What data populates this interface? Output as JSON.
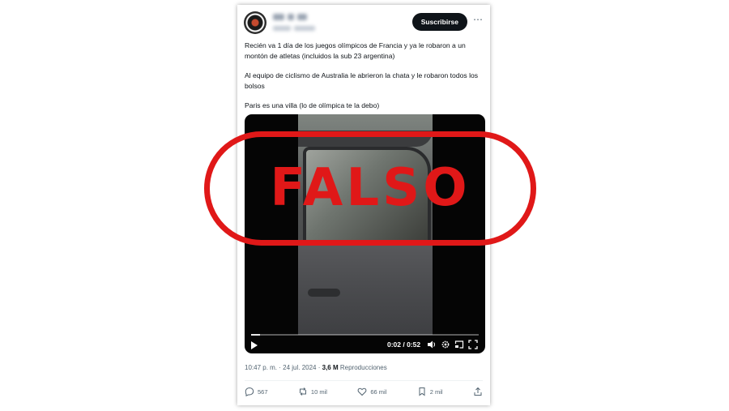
{
  "post": {
    "subscribe_label": "Suscribirse",
    "more_label": "⋯",
    "paragraphs": [
      "Recién va 1 día de los juegos olímpicos de Francia y ya le robaron a un montón de atletas (incluidos la sub 23 argentina)",
      "Al equipo de ciclismo de Australia le abrieron la chata y le robaron todos los bolsos",
      "Paris es una villa (lo de olímpica te la debo)"
    ],
    "video": {
      "time": "0:02 / 0:52",
      "progress": 0.04
    },
    "meta": {
      "time": "10:47 p. m.",
      "date": "24 jul. 2024",
      "views_count": "3,6 M",
      "views_label": "Reproducciones"
    },
    "actions": {
      "replies": "567",
      "reposts": "10 mil",
      "likes": "66 mil",
      "bookmarks": "2 mil"
    }
  },
  "stamp": {
    "text": "FALSO",
    "color": "#e01818"
  }
}
